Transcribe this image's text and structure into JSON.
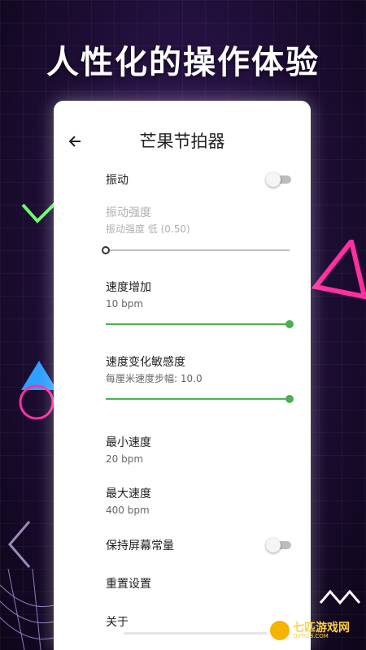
{
  "promo": {
    "headline": "人性化的操作体验"
  },
  "app": {
    "title": "芒果节拍器"
  },
  "settings": {
    "vibration": {
      "label": "振动",
      "enabled": false
    },
    "vibration_strength": {
      "label": "振动强度",
      "summary": "振动强度 低 (0.50)",
      "value": 0.0,
      "enabled": false
    },
    "speed_increase": {
      "label": "速度增加",
      "summary": "10 bpm",
      "value": 1.0
    },
    "speed_sensitivity": {
      "label": "速度变化敏感度",
      "summary": "每厘米速度步幅: 10.0",
      "value": 1.0
    },
    "min_speed": {
      "label": "最小速度",
      "summary": "20 bpm"
    },
    "max_speed": {
      "label": "最大速度",
      "summary": "400 bpm"
    },
    "keep_screen_on": {
      "label": "保持屏幕常量",
      "enabled": false
    },
    "reset": {
      "label": "重置设置"
    },
    "about": {
      "label": "关于"
    }
  },
  "watermark": {
    "name": "七匹游戏网",
    "url": "QIP828.COM"
  },
  "colors": {
    "accent": "#4caf50",
    "background": "#1d0d34",
    "watermark": "#ffd23f"
  },
  "icons": {
    "back": "arrow-left-icon"
  }
}
